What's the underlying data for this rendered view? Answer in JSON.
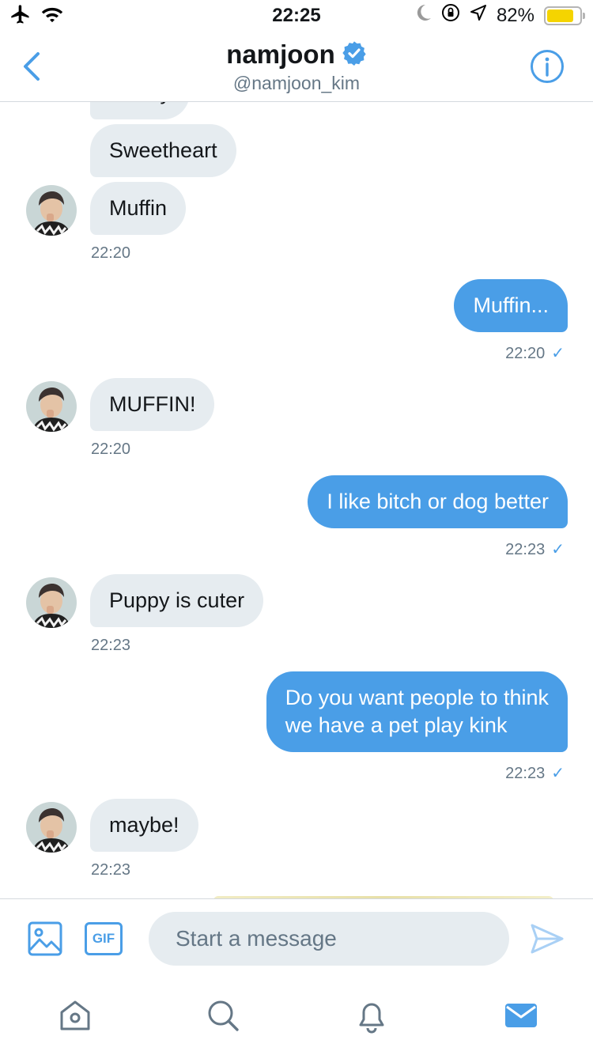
{
  "status_bar": {
    "time": "22:25",
    "battery": "82%",
    "battery_level": 0.82,
    "battery_color": "#f5d400"
  },
  "header": {
    "name": "namjoon",
    "handle": "@namjoon_kim",
    "verified_icon": "verified-badge-icon",
    "back_icon": "chevron-left-icon",
    "info_icon": "info-icon"
  },
  "messages": [
    {
      "side": "in",
      "text": "Honey"
    },
    {
      "side": "in",
      "text": "Sweetheart"
    },
    {
      "side": "in",
      "text": "Muffin"
    },
    {
      "side": "meta",
      "time": "22:20"
    },
    {
      "side": "out",
      "text": "Muffin..."
    },
    {
      "side": "meta",
      "time": "22:20",
      "check": "✓"
    },
    {
      "side": "in",
      "text": "MUFFIN!"
    },
    {
      "side": "meta",
      "time": "22:20"
    },
    {
      "side": "out",
      "text": "I like bitch or dog better"
    },
    {
      "side": "meta",
      "time": "22:23",
      "check": "✓"
    },
    {
      "side": "in",
      "text": "Puppy is cuter"
    },
    {
      "side": "meta",
      "time": "22:23"
    },
    {
      "side": "out",
      "lines": [
        "Do you want people to think",
        "we have a pet play kink"
      ]
    },
    {
      "side": "meta",
      "time": "22:23",
      "check": "✓"
    },
    {
      "side": "in",
      "text": "maybe!"
    },
    {
      "side": "meta",
      "time": "22:23"
    }
  ],
  "composer": {
    "placeholder": "Start a message",
    "gif_label": "GIF",
    "media_icon": "image-icon",
    "send_icon": "send-icon"
  },
  "nav": {
    "items": [
      "home-icon",
      "search-icon",
      "notifications-icon",
      "messages-icon"
    ],
    "active": "messages-icon"
  },
  "colors": {
    "accent": "#4a9ee7",
    "incoming_bubble": "#e6ecf0",
    "secondary_text": "#657786"
  }
}
